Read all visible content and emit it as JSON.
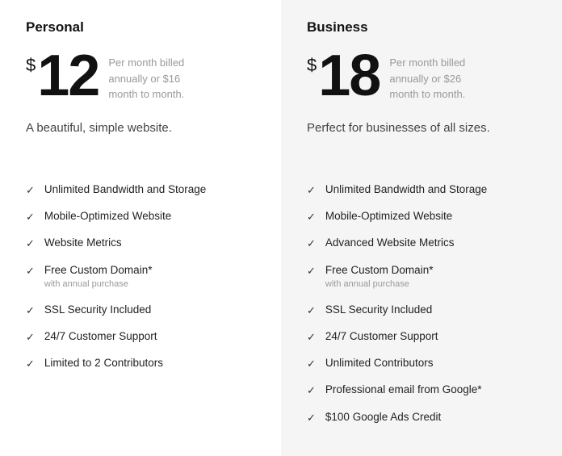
{
  "personal": {
    "name": "Personal",
    "currency": "$",
    "price": "12",
    "price_desc": "Per month billed annually or $16 month to month.",
    "tagline": "A beautiful, simple website.",
    "features": [
      {
        "text": "Unlimited Bandwidth and Storage",
        "sub": null
      },
      {
        "text": "Mobile-Optimized Website",
        "sub": null
      },
      {
        "text": "Website Metrics",
        "sub": null
      },
      {
        "text": "Free Custom Domain*",
        "sub": "with annual purchase"
      },
      {
        "text": "SSL Security Included",
        "sub": null
      },
      {
        "text": "24/7 Customer Support",
        "sub": null
      },
      {
        "text": "Limited to 2 Contributors",
        "sub": null
      }
    ]
  },
  "business": {
    "name": "Business",
    "currency": "$",
    "price": "18",
    "price_desc": "Per month billed annually or $26 month to month.",
    "tagline": "Perfect for businesses of all sizes.",
    "features": [
      {
        "text": "Unlimited Bandwidth and Storage",
        "sub": null
      },
      {
        "text": "Mobile-Optimized Website",
        "sub": null
      },
      {
        "text": "Advanced Website Metrics",
        "sub": null
      },
      {
        "text": "Free Custom Domain*",
        "sub": "with annual purchase"
      },
      {
        "text": "SSL Security Included",
        "sub": null
      },
      {
        "text": "24/7 Customer Support",
        "sub": null
      },
      {
        "text": "Unlimited Contributors",
        "sub": null
      },
      {
        "text": "Professional email from Google*",
        "sub": null
      },
      {
        "text": "$100 Google Ads Credit",
        "sub": null
      }
    ]
  },
  "check_symbol": "✓"
}
